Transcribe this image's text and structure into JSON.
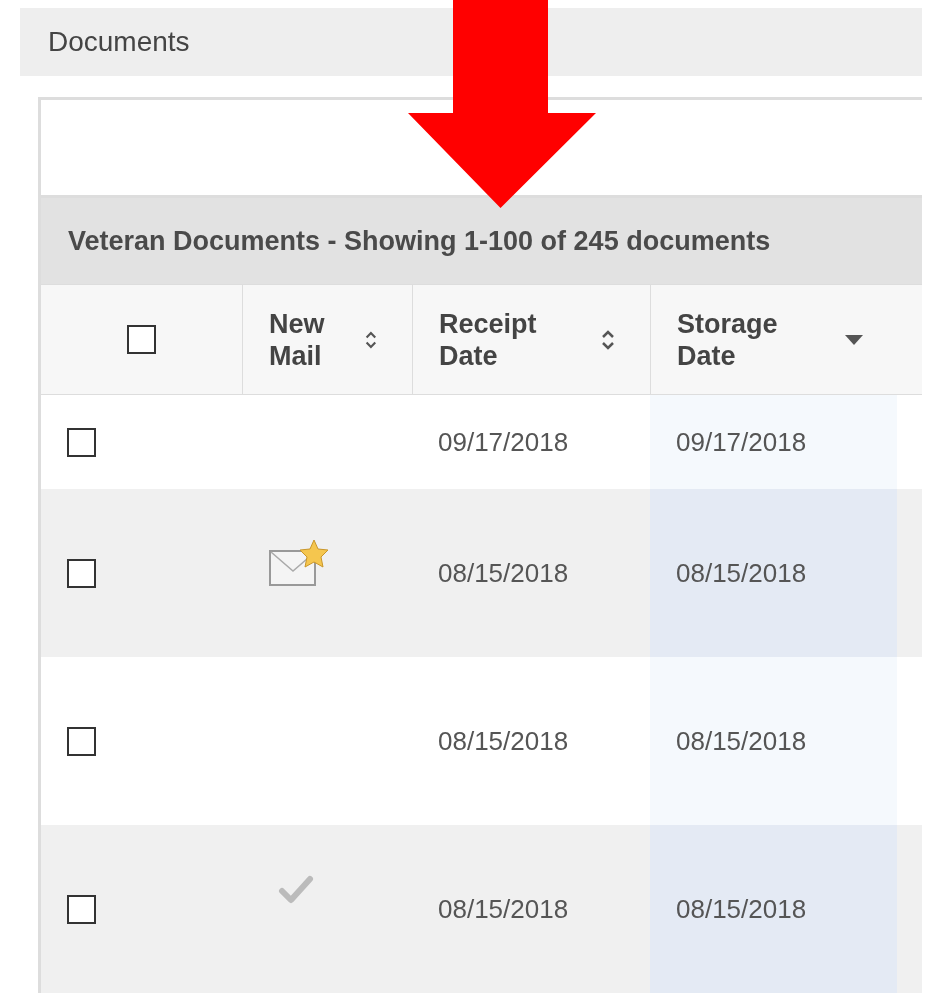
{
  "header": {
    "title": "Documents"
  },
  "table": {
    "title": "Veteran Documents - Showing 1-100 of 245 documents",
    "select_all": {
      "checked": false
    },
    "columns": [
      {
        "label": "New Mail",
        "kind": "sortable"
      },
      {
        "label": "Receipt Date",
        "kind": "sortable"
      },
      {
        "label": "Storage Date",
        "kind": "sorted"
      }
    ],
    "rows": [
      {
        "checked": false,
        "kind": "plain",
        "receipt_date": "09/17/2018",
        "storage_date": "09/17/2018"
      },
      {
        "checked": false,
        "kind": "new",
        "receipt_date": "08/15/2018",
        "storage_date": "08/15/2018"
      },
      {
        "checked": false,
        "kind": "plain",
        "receipt_date": "08/15/2018",
        "storage_date": "08/15/2018"
      },
      {
        "checked": false,
        "kind": "read",
        "receipt_date": "08/15/2018",
        "storage_date": "08/15/2018"
      }
    ]
  }
}
